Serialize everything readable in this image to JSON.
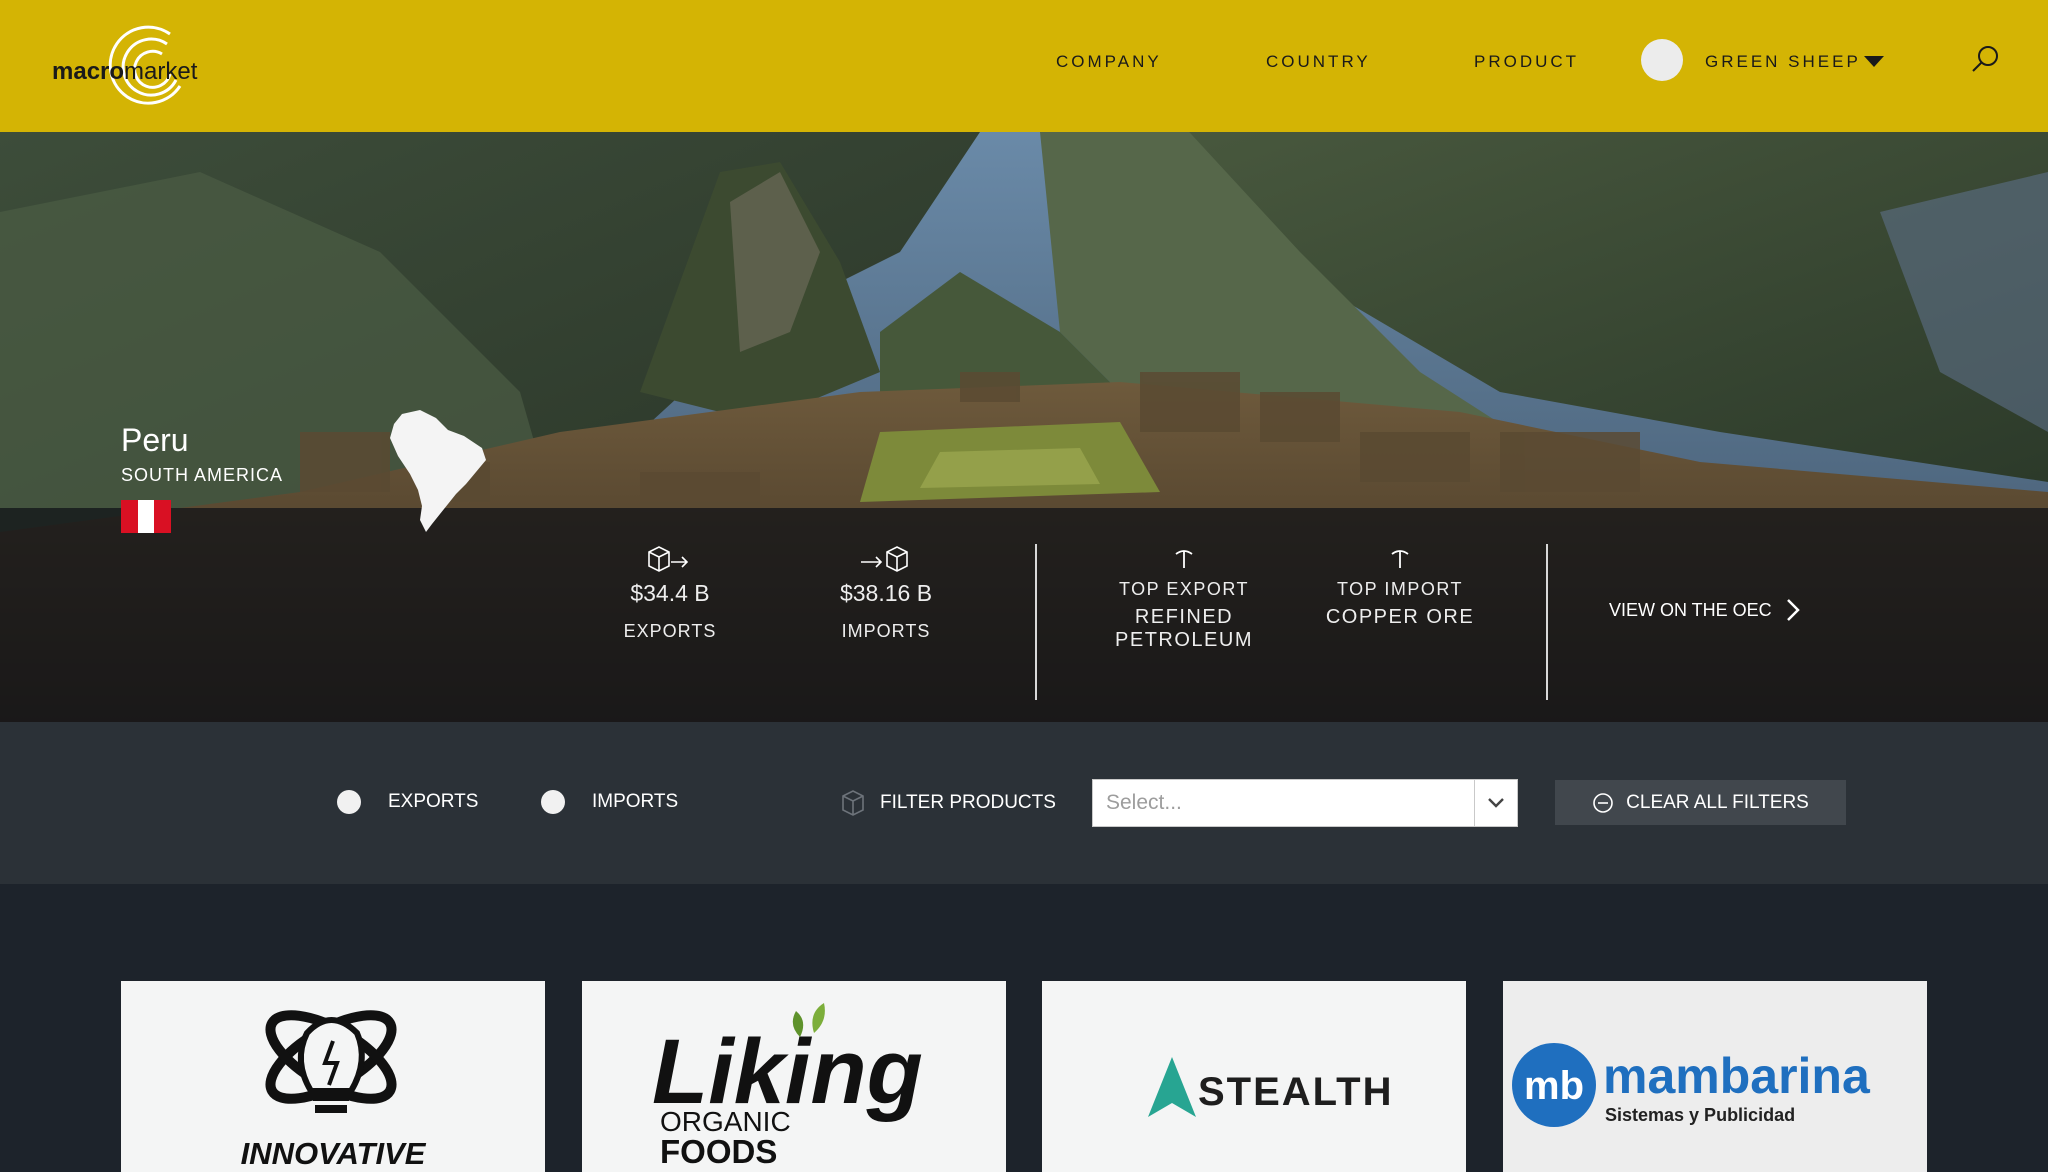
{
  "header": {
    "logo": {
      "bold": "macro",
      "thin": "market"
    },
    "nav": [
      "COMPANY",
      "COUNTRY",
      "PRODUCT"
    ],
    "user": {
      "name": "GREEN SHEEP"
    },
    "icons": {
      "search": "search-icon",
      "caret": "caret-down-icon"
    }
  },
  "hero": {
    "country": {
      "name": "Peru",
      "region": "SOUTH AMERICA",
      "flag_colors": [
        "#d91023",
        "#ffffff",
        "#d91023"
      ]
    },
    "exports": {
      "value": "$34.4 B",
      "label": "EXPORTS"
    },
    "imports": {
      "value": "$38.16 B",
      "label": "IMPORTS"
    },
    "top_export": {
      "label": "TOP EXPORT",
      "value": "REFINED PETROLEUM"
    },
    "top_import": {
      "label": "TOP IMPORT",
      "value": "COPPER ORE"
    },
    "oec_link": "VIEW ON THE OEC"
  },
  "filters": {
    "exports_label": "EXPORTS",
    "imports_label": "IMPORTS",
    "filter_products_label": "FILTER PRODUCTS",
    "select_placeholder": "Select...",
    "clear_label": "CLEAR ALL FILTERS"
  },
  "companies": [
    {
      "logo_text": "INNOVATIVE"
    },
    {
      "logo_text": "Liking",
      "logo_sub_1": "ORGANIC",
      "logo_sub_2": "FOODS"
    },
    {
      "logo_text": "STEALTH"
    },
    {
      "logo_text": "mambarina",
      "logo_sub_1": "Sistemas y Publicidad",
      "logo_mark": "mb"
    }
  ],
  "colors": {
    "header": "#d4b404",
    "filter_bar": "#2b3137",
    "page_bg": "#1d232b",
    "stealth_teal": "#27a592",
    "mambarina_blue": "#1f6fbf"
  }
}
